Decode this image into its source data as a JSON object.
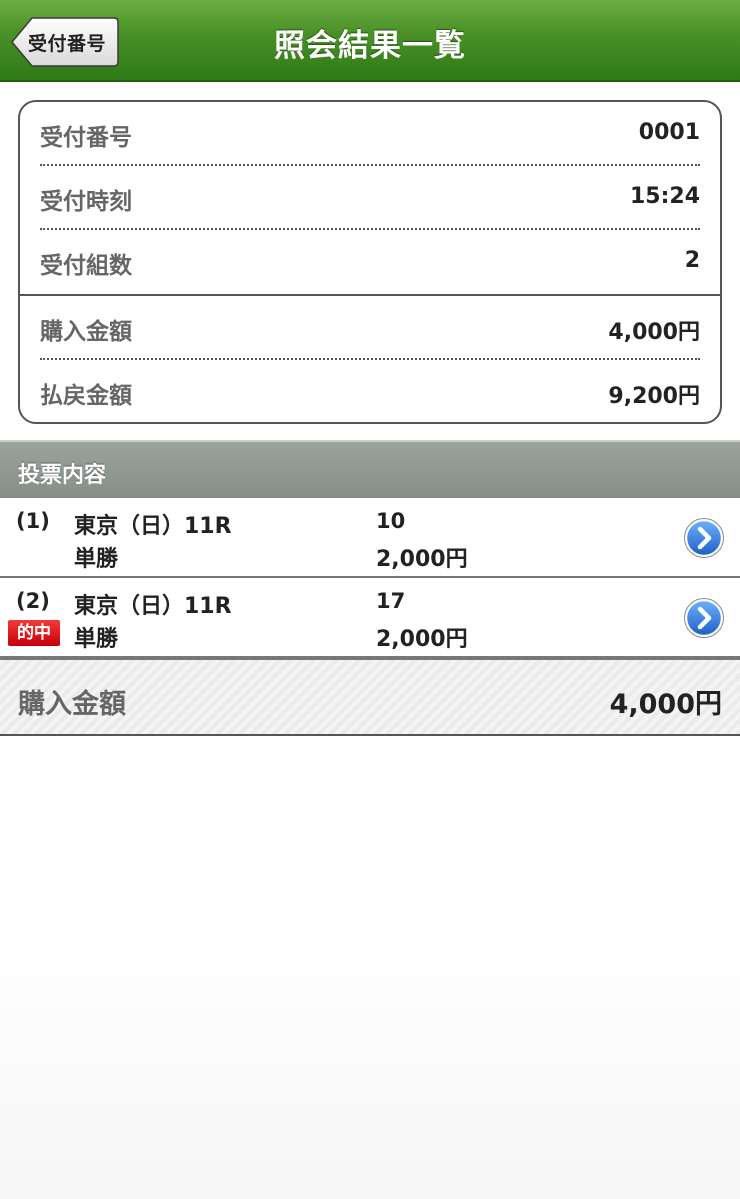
{
  "navbar": {
    "title": "照会結果一覧",
    "back_label": "受付番号"
  },
  "summary": {
    "rows": [
      {
        "label": "受付番号",
        "value": "0001"
      },
      {
        "label": "受付時刻",
        "value": "15:24"
      },
      {
        "label": "受付組数",
        "value": "2"
      },
      {
        "label": "購入金額",
        "value": "4,000円"
      },
      {
        "label": "払戻金額",
        "value": "9,200円"
      }
    ]
  },
  "section": {
    "title": "投票内容"
  },
  "bets": [
    {
      "num": "(1)",
      "race": "東京（日）11R",
      "type": "単勝",
      "horse": "10",
      "amount": "2,000円",
      "hit": ""
    },
    {
      "num": "(2)",
      "race": "東京（日）11R",
      "type": "単勝",
      "horse": "17",
      "amount": "2,000円",
      "hit": "的中"
    }
  ],
  "total": {
    "label": "購入金額",
    "value": "4,000円"
  },
  "colors": {
    "navbar": "#3f8a20",
    "hit_badge": "#d8000c",
    "chevron": "#2b78d6"
  },
  "icons": {
    "back": "back-arrow-button",
    "row_detail": "chevron-right-icon"
  }
}
